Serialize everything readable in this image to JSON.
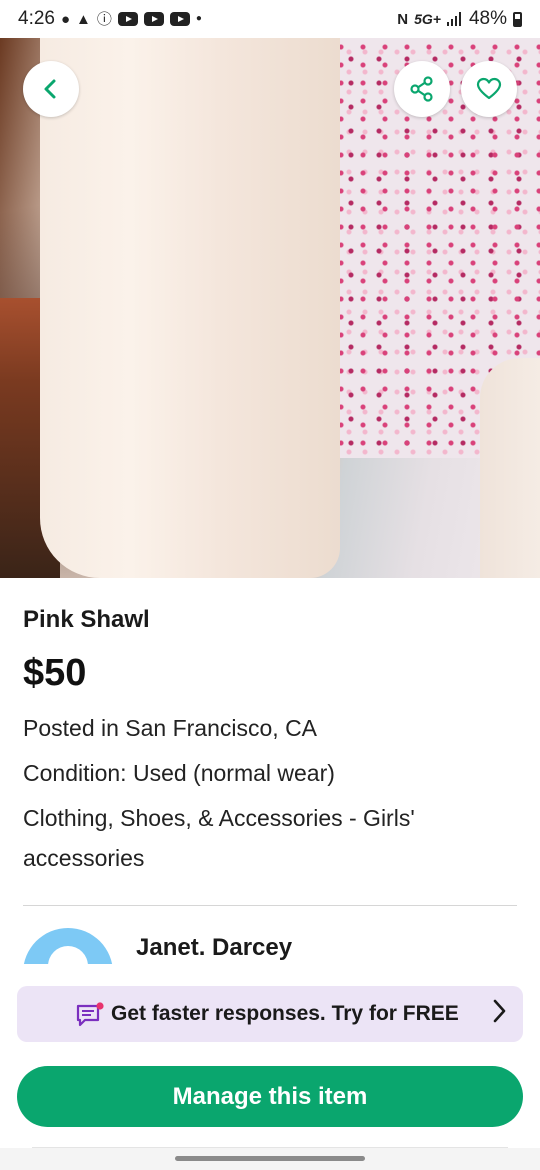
{
  "status_bar": {
    "time": "4:26",
    "network": "5G+",
    "battery": "48%"
  },
  "hero": {
    "image_alt": "Pink Shawl"
  },
  "listing": {
    "title": "Pink Shawl",
    "price": "$50",
    "posted": "Posted in San Francisco, CA",
    "condition": "Condition: Used (normal wear)",
    "category": "Clothing, Shoes, & Accessories - Girls' accessories"
  },
  "seller": {
    "name": "Janet. Darcey"
  },
  "promo": {
    "label": "Get faster responses. Try for FREE"
  },
  "actions": {
    "manage_label": "Manage this item"
  },
  "colors": {
    "accent_green": "#0aa66e",
    "promo_bg": "#ece4f6",
    "avatar_blue": "#7dc9f5",
    "icon_green": "#0aa66e"
  },
  "icons": [
    "chat-icon",
    "warning-icon",
    "info-icon",
    "youtube-icon",
    "nfc-icon",
    "signal-icon",
    "battery-icon",
    "back-icon",
    "share-icon",
    "heart-icon",
    "message-promo-icon",
    "chevron-right-icon"
  ]
}
